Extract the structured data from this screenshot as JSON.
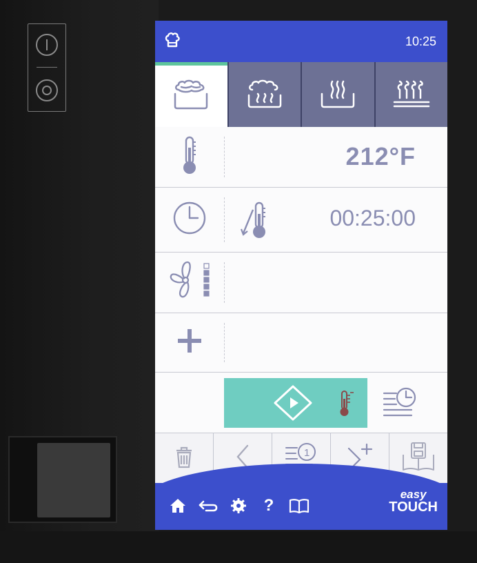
{
  "status_bar": {
    "time": "10:25"
  },
  "cooking_modes": [
    {
      "name": "hot-air",
      "active": true
    },
    {
      "name": "combi-steam",
      "active": false
    },
    {
      "name": "steam",
      "active": false
    },
    {
      "name": "low-temperature-steam",
      "active": false
    }
  ],
  "temperature": {
    "value": "212°F"
  },
  "cooking_time": {
    "value": "00:25:00"
  },
  "fan_speed": {
    "level": 4,
    "max": 5
  },
  "colors": {
    "header_blue": "#3c4fcc",
    "active_tab_indicator": "#5ec59c",
    "inactive_tab": "#6d7195",
    "start_button": "#6fcdc1",
    "value_text": "#8a8db2"
  },
  "footer": {
    "help_label": "?",
    "logo_line1": "easy",
    "logo_line2": "TOUCH"
  },
  "icons": {
    "chef": "chef-hat-icon",
    "thermometer": "thermometer-icon",
    "clock": "clock-icon",
    "core_probe": "core-probe-icon",
    "fan": "fan-icon",
    "add": "plus-icon",
    "play": "play-icon",
    "schedule": "schedule-icon",
    "trash": "trash-icon",
    "back": "chevron-left-icon",
    "program": "program-icon",
    "add_step": "add-step-icon",
    "save": "save-book-icon",
    "home": "home-icon",
    "return": "return-icon",
    "settings": "gear-icon",
    "manual": "book-icon"
  }
}
